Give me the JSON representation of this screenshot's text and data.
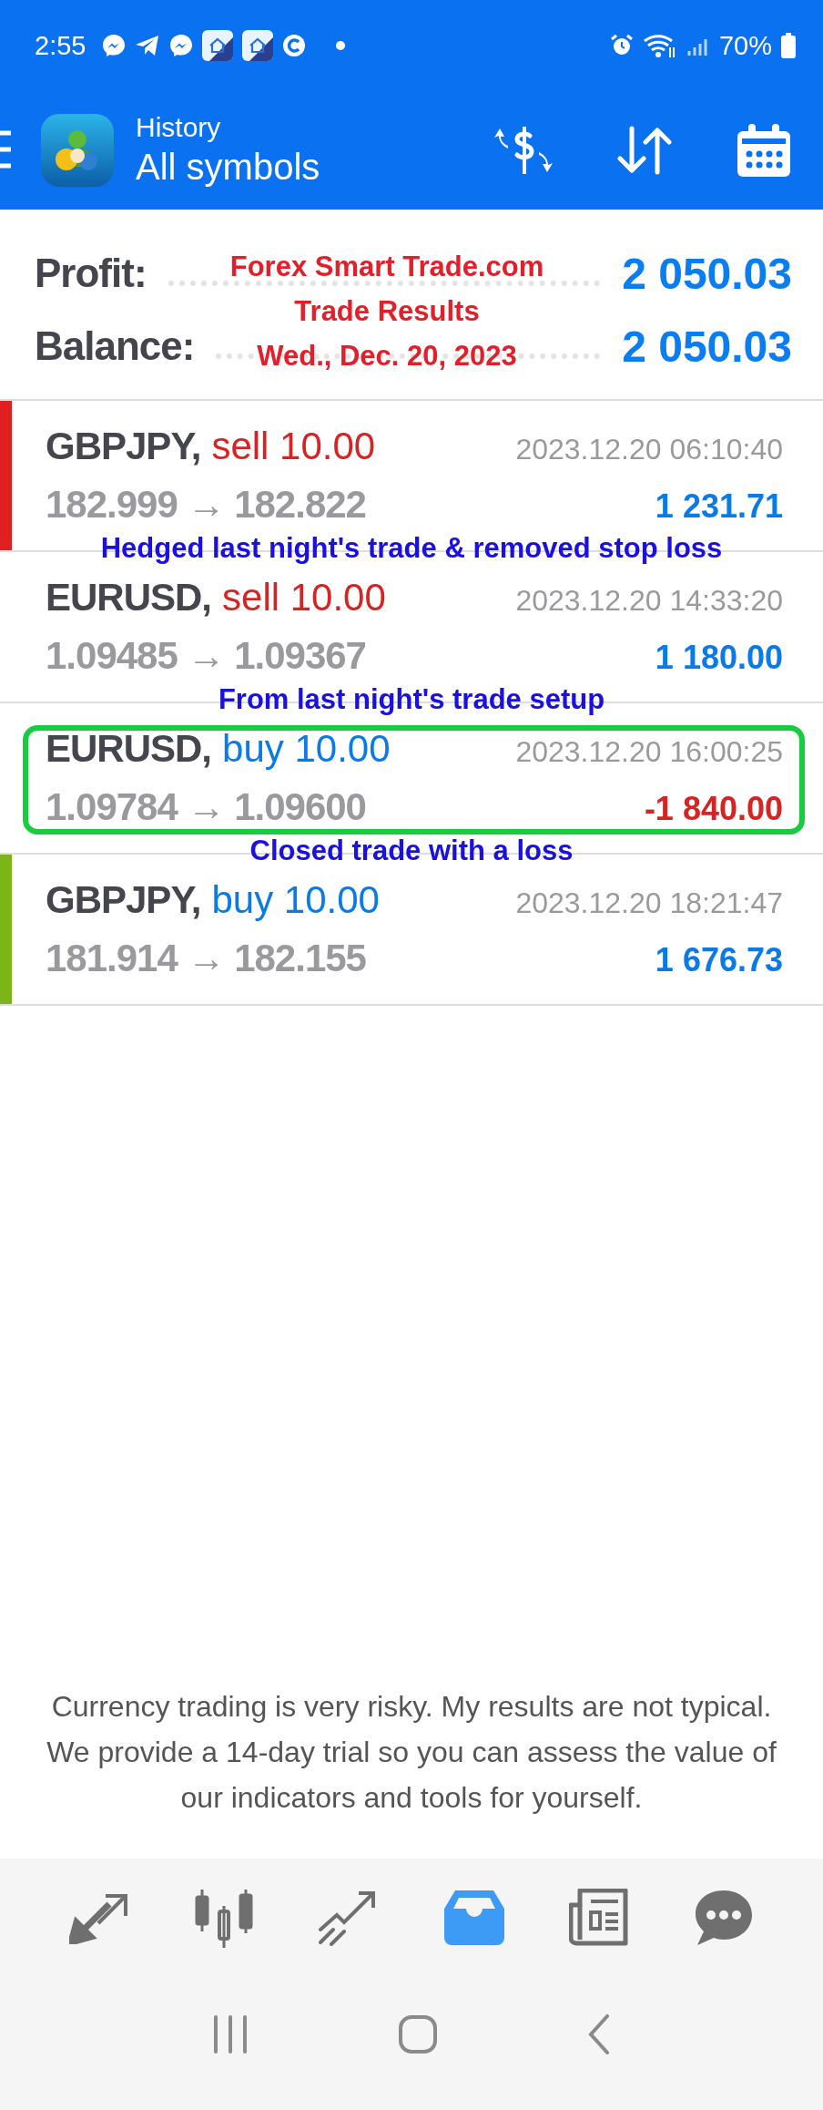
{
  "status_bar": {
    "time": "2:55",
    "battery": "70%"
  },
  "header": {
    "title": "History",
    "subtitle": "All symbols"
  },
  "summary": {
    "rows": [
      {
        "label": "Profit:",
        "value": "2 050.03"
      },
      {
        "label": "Balance:",
        "value": "2 050.03"
      }
    ],
    "caption": [
      "Forex Smart Trade.com",
      "Trade Results",
      "Wed., Dec. 20, 2023"
    ]
  },
  "trades": [
    {
      "symbol": "GBPJPY,",
      "order": "sell 10.00",
      "kind": "sell",
      "time": "2023.12.20 06:10:40",
      "prices": "182.999 → 182.822",
      "profit": "1 231.71",
      "loss": false,
      "color": "#e02020",
      "highlighted": false
    },
    {
      "annotation": "Hedged last night's trade & removed stop loss",
      "symbol": "EURUSD,",
      "order": "sell 10.00",
      "kind": "sell",
      "time": "2023.12.20 14:33:20",
      "prices": "1.09485 → 1.09367",
      "profit": "1 180.00",
      "loss": false,
      "highlighted": false
    },
    {
      "annotation": "From last night's trade setup",
      "symbol": "EURUSD,",
      "order": "buy 10.00",
      "kind": "buy",
      "time": "2023.12.20 16:00:25",
      "prices": "1.09784 → 1.09600",
      "profit": "-1 840.00",
      "loss": true,
      "highlighted": true
    },
    {
      "annotation": "Closed trade with a loss",
      "symbol": "GBPJPY,",
      "order": "buy 10.00",
      "kind": "buy",
      "time": "2023.12.20 18:21:47",
      "prices": "181.914 → 182.155",
      "profit": "1 676.73",
      "loss": false,
      "color": "#7cb518",
      "highlighted": false
    }
  ],
  "disclaimer": "Currency trading is very risky. My results are not typical. We provide a 14-day trial so you can assess the value of our indicators and tools for yourself.",
  "nav_tabs": [
    {
      "kind": "trade",
      "selected": false
    },
    {
      "kind": "chart",
      "selected": false
    },
    {
      "kind": "analytics",
      "selected": false
    },
    {
      "kind": "history",
      "selected": true
    },
    {
      "kind": "news",
      "selected": false
    },
    {
      "kind": "chat",
      "selected": false
    }
  ],
  "system_nav": [
    {
      "kind": "recents"
    },
    {
      "kind": "home"
    },
    {
      "kind": "back"
    }
  ]
}
